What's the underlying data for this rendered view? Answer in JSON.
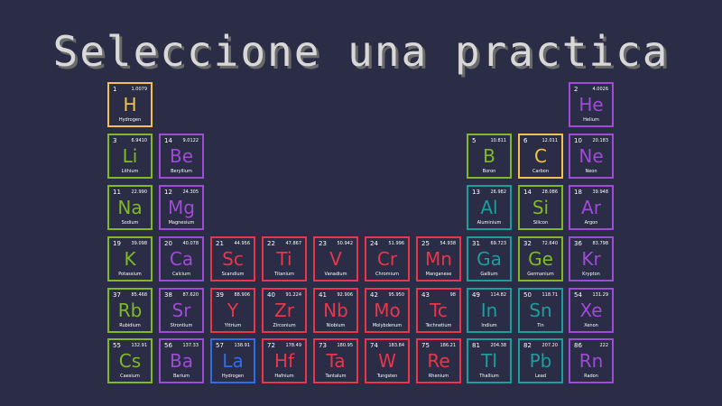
{
  "title": "Seleccione una practica",
  "colors": {
    "yellow": "#f2c14e",
    "purple": "#a04ad8",
    "green": "#7fba22",
    "red": "#e8364b",
    "teal": "#1a9e9e",
    "blue": "#2f6ee8"
  },
  "elements": [
    {
      "number": "1",
      "symbol": "H",
      "name": "Hydrogen",
      "mass": "1.0079",
      "color": "yellow"
    },
    {
      "number": "2",
      "symbol": "He",
      "name": "Helium",
      "mass": "4.0026",
      "color": "purple"
    },
    {
      "number": "3",
      "symbol": "Li",
      "name": "Lithium",
      "mass": "6.9410",
      "color": "green"
    },
    {
      "number": "14",
      "symbol": "Be",
      "name": "Beryllium",
      "mass": "9.0122",
      "color": "purple"
    },
    {
      "number": "5",
      "symbol": "B",
      "name": "Boron",
      "mass": "10.811",
      "color": "green"
    },
    {
      "number": "6",
      "symbol": "C",
      "name": "Carbon",
      "mass": "12.011",
      "color": "yellow"
    },
    {
      "number": "10",
      "symbol": "Ne",
      "name": "Neon",
      "mass": "20.183",
      "color": "purple"
    },
    {
      "number": "11",
      "symbol": "Na",
      "name": "Sodium",
      "mass": "22.990",
      "color": "green"
    },
    {
      "number": "12",
      "symbol": "Mg",
      "name": "Magnesium",
      "mass": "24.305",
      "color": "purple"
    },
    {
      "number": "13",
      "symbol": "Al",
      "name": "Aluminium",
      "mass": "26.982",
      "color": "teal"
    },
    {
      "number": "14",
      "symbol": "Si",
      "name": "Silicon",
      "mass": "28.086",
      "color": "green"
    },
    {
      "number": "18",
      "symbol": "Ar",
      "name": "Argon",
      "mass": "39.948",
      "color": "purple"
    },
    {
      "number": "19",
      "symbol": "K",
      "name": "Potassium",
      "mass": "39.098",
      "color": "green"
    },
    {
      "number": "20",
      "symbol": "Ca",
      "name": "Calcium",
      "mass": "40.078",
      "color": "purple"
    },
    {
      "number": "21",
      "symbol": "Sc",
      "name": "Scandium",
      "mass": "44.956",
      "color": "red"
    },
    {
      "number": "22",
      "symbol": "Ti",
      "name": "Titanium",
      "mass": "47.867",
      "color": "red"
    },
    {
      "number": "23",
      "symbol": "V",
      "name": "Vanadium",
      "mass": "50.942",
      "color": "red"
    },
    {
      "number": "24",
      "symbol": "Cr",
      "name": "Chromium",
      "mass": "51.996",
      "color": "red"
    },
    {
      "number": "25",
      "symbol": "Mn",
      "name": "Manganese",
      "mass": "54.938",
      "color": "red"
    },
    {
      "number": "31",
      "symbol": "Ga",
      "name": "Gallium",
      "mass": "69.723",
      "color": "teal"
    },
    {
      "number": "32",
      "symbol": "Ge",
      "name": "Germanium",
      "mass": "72.640",
      "color": "green"
    },
    {
      "number": "36",
      "symbol": "Kr",
      "name": "Krypton",
      "mass": "83.798",
      "color": "purple"
    },
    {
      "number": "37",
      "symbol": "Rb",
      "name": "Rubidium",
      "mass": "85.468",
      "color": "green"
    },
    {
      "number": "38",
      "symbol": "Sr",
      "name": "Strontium",
      "mass": "87.620",
      "color": "purple"
    },
    {
      "number": "39",
      "symbol": "Y",
      "name": "Yttrium",
      "mass": "88.906",
      "color": "red"
    },
    {
      "number": "40",
      "symbol": "Zr",
      "name": "Zirconium",
      "mass": "91.224",
      "color": "red"
    },
    {
      "number": "41",
      "symbol": "Nb",
      "name": "Niobium",
      "mass": "92.906",
      "color": "red"
    },
    {
      "number": "42",
      "symbol": "Mo",
      "name": "Molybdenum",
      "mass": "95.950",
      "color": "red"
    },
    {
      "number": "43",
      "symbol": "Tc",
      "name": "Technetium",
      "mass": "98",
      "color": "red"
    },
    {
      "number": "49",
      "symbol": "In",
      "name": "Indium",
      "mass": "114.82",
      "color": "teal"
    },
    {
      "number": "50",
      "symbol": "Sn",
      "name": "Tin",
      "mass": "118.71",
      "color": "teal"
    },
    {
      "number": "54",
      "symbol": "Xe",
      "name": "Xenon",
      "mass": "131.29",
      "color": "purple"
    },
    {
      "number": "55",
      "symbol": "Cs",
      "name": "Caesium",
      "mass": "132.91",
      "color": "green"
    },
    {
      "number": "56",
      "symbol": "Ba",
      "name": "Barium",
      "mass": "137.33",
      "color": "purple"
    },
    {
      "number": "57",
      "symbol": "La",
      "name": "Hydrogen",
      "mass": "138.91",
      "color": "blue"
    },
    {
      "number": "72",
      "symbol": "Hf",
      "name": "Hafnium",
      "mass": "178.49",
      "color": "red"
    },
    {
      "number": "73",
      "symbol": "Ta",
      "name": "Tantalum",
      "mass": "180.95",
      "color": "red"
    },
    {
      "number": "74",
      "symbol": "W",
      "name": "Tungsten",
      "mass": "183.84",
      "color": "red"
    },
    {
      "number": "75",
      "symbol": "Re",
      "name": "Rhenium",
      "mass": "186.21",
      "color": "red"
    },
    {
      "number": "81",
      "symbol": "Tl",
      "name": "Thallium",
      "mass": "204.38",
      "color": "teal"
    },
    {
      "number": "82",
      "symbol": "Pb",
      "name": "Lead",
      "mass": "207.20",
      "color": "teal"
    },
    {
      "number": "86",
      "symbol": "Rn",
      "name": "Radon",
      "mass": "222",
      "color": "purple"
    }
  ]
}
